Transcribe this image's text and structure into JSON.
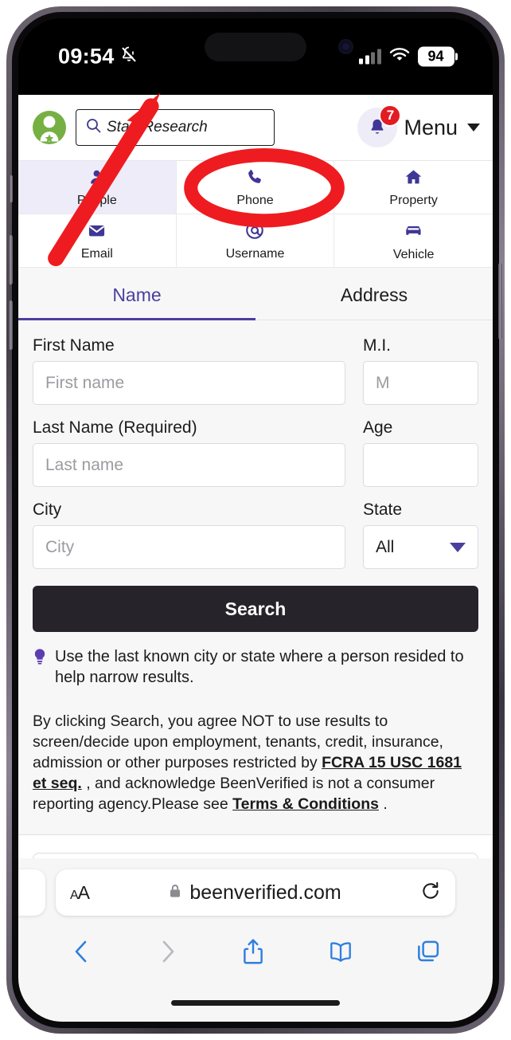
{
  "status_bar": {
    "time": "09:54",
    "silent_icon": "bell-slash-icon",
    "signal_icon": "cellular-signal-icon",
    "wifi_icon": "wifi-icon",
    "battery_level": "94"
  },
  "site_header": {
    "logo_name": "beenverified-logo",
    "search": {
      "placeholder": "Start Research",
      "value": "",
      "icon": "search-icon"
    },
    "notifications": {
      "icon": "bell-icon",
      "badge_count": "7"
    },
    "menu_label": "Menu",
    "menu_caret": "chevron-down-icon"
  },
  "categories": [
    {
      "label": "People",
      "icon": "person-icon",
      "active": true
    },
    {
      "label": "Phone",
      "icon": "phone-icon",
      "active": false
    },
    {
      "label": "Property",
      "icon": "home-icon",
      "active": false
    },
    {
      "label": "Email",
      "icon": "envelope-icon",
      "active": false
    },
    {
      "label": "Username",
      "icon": "at-sign-icon",
      "active": false
    },
    {
      "label": "Vehicle",
      "icon": "car-icon",
      "active": false
    }
  ],
  "form_tabs": [
    {
      "label": "Name",
      "active": true
    },
    {
      "label": "Address",
      "active": false
    }
  ],
  "form": {
    "first_name": {
      "label": "First Name",
      "placeholder": "First name",
      "value": ""
    },
    "middle_init": {
      "label": "M.I.",
      "placeholder": "M",
      "value": ""
    },
    "last_name": {
      "label": "Last Name (Required)",
      "placeholder": "Last name",
      "value": ""
    },
    "age": {
      "label": "Age",
      "placeholder": "",
      "value": ""
    },
    "city": {
      "label": "City",
      "placeholder": "City",
      "value": ""
    },
    "state": {
      "label": "State",
      "selected": "All",
      "caret": "chevron-down-icon"
    },
    "search_button": "Search"
  },
  "tip": {
    "icon": "lightbulb-icon",
    "text": "Use the last known city or state where a person resided to help narrow results."
  },
  "disclaimer": {
    "part1": "By clicking Search, you agree NOT to use results to screen/decide upon employment, tenants, credit, insurance, admission or other purposes restricted by ",
    "link1": "FCRA 15 USC 1681 et seq.",
    "part2": " , and acknowledge BeenVerified is not a consumer reporting agency.Please see ",
    "link2": "Terms & Conditions",
    "part3": " ."
  },
  "safari": {
    "text_size_button": "AA",
    "lock_icon": "lock-icon",
    "url": "beenverified.com",
    "reload_icon": "reload-icon",
    "back_icon": "chevron-left-icon",
    "forward_icon": "chevron-right-icon",
    "share_icon": "share-icon",
    "bookmarks_icon": "book-icon",
    "tabs_icon": "tabs-icon"
  },
  "annotations": {
    "arrow": "red-arrow-pointing-to-search-box",
    "oval": "red-oval-highlighting-phone-tab",
    "color": "#ee1c20"
  },
  "colors": {
    "brand_purple": "#4a3f9e",
    "brand_green": "#76b043",
    "badge_red": "#e31b23",
    "button_dark": "#26242a",
    "page_bg": "#f7f7f8",
    "safari_blue": "#2f7fe0"
  }
}
